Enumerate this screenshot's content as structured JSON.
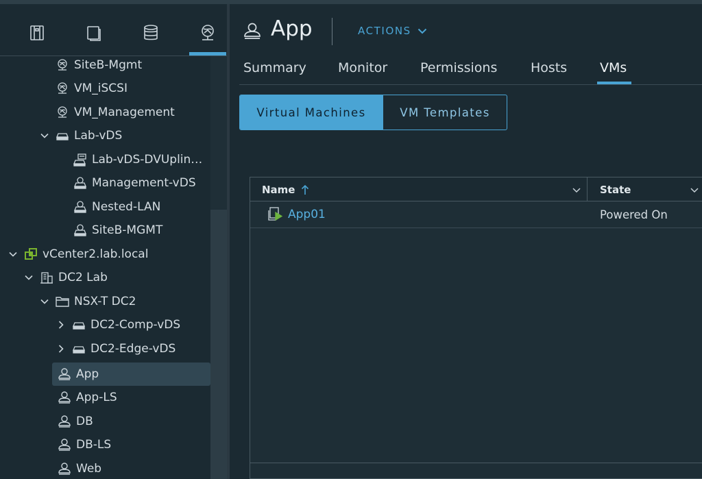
{
  "sidebar": {
    "tabs": [
      {
        "name": "hosts-clusters",
        "icon": "hosts-clusters-icon"
      },
      {
        "name": "vms-templates",
        "icon": "vms-templates-icon"
      },
      {
        "name": "storage",
        "icon": "storage-icon"
      },
      {
        "name": "networking",
        "icon": "networking-icon",
        "active": true
      }
    ],
    "tree": [
      {
        "label": "SiteB-Mgmt",
        "icon": "network-icon"
      },
      {
        "label": "VM_iSCSI",
        "icon": "network-icon"
      },
      {
        "label": "VM_Management",
        "icon": "network-icon"
      },
      {
        "label": "Lab-vDS",
        "icon": "vds-icon",
        "expanded": true
      },
      {
        "label": "Lab-vDS-DVUplin…",
        "icon": "uplink-icon"
      },
      {
        "label": "Management-vDS",
        "icon": "portgroup-icon"
      },
      {
        "label": "Nested-LAN",
        "icon": "portgroup-icon"
      },
      {
        "label": "SiteB-MGMT",
        "icon": "portgroup-icon"
      },
      {
        "label": "vCenter2.lab.local",
        "icon": "vcenter-icon",
        "expanded": true
      },
      {
        "label": "DC2 Lab",
        "icon": "datacenter-icon",
        "expanded": true
      },
      {
        "label": "NSX-T DC2",
        "icon": "folder-icon",
        "expanded": true
      },
      {
        "label": "DC2-Comp-vDS",
        "icon": "vds-icon",
        "expanded": false
      },
      {
        "label": "DC2-Edge-vDS",
        "icon": "vds-icon",
        "expanded": false
      },
      {
        "label": "App",
        "icon": "segment-icon",
        "selected": true
      },
      {
        "label": "App-LS",
        "icon": "segment-icon"
      },
      {
        "label": "DB",
        "icon": "segment-icon"
      },
      {
        "label": "DB-LS",
        "icon": "segment-icon"
      },
      {
        "label": "Web",
        "icon": "segment-icon"
      }
    ]
  },
  "header": {
    "title": "App",
    "actions_label": "ACTIONS"
  },
  "tabs": [
    {
      "label": "Summary"
    },
    {
      "label": "Monitor"
    },
    {
      "label": "Permissions"
    },
    {
      "label": "Hosts"
    },
    {
      "label": "VMs",
      "active": true
    }
  ],
  "toggle": {
    "selected": "Virtual Machines",
    "other": "VM Templates"
  },
  "grid": {
    "columns": [
      {
        "label": "Name",
        "sorted": "ascending"
      },
      {
        "label": "State"
      }
    ],
    "rows": [
      {
        "name": "App01",
        "state": "Powered On"
      }
    ]
  },
  "colors": {
    "accent": "#4aa4d4",
    "background": "#1b2a32",
    "vcenter_green": "#7ab32e",
    "vm_powered_on": "#6db33f"
  }
}
